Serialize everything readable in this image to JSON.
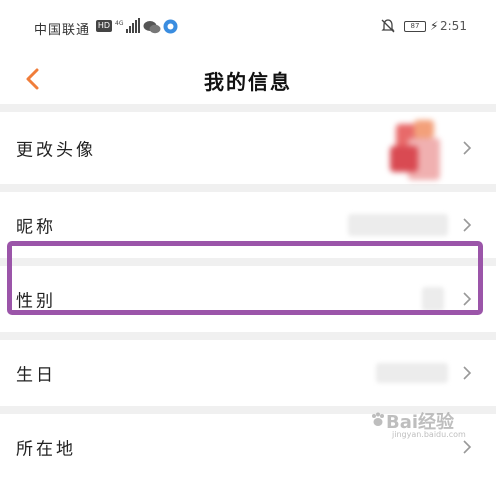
{
  "status_bar": {
    "carrier": "中国联通",
    "hd_badge": "HD",
    "battery": "87",
    "time": "2:51"
  },
  "nav": {
    "title": "我的信息"
  },
  "rows": [
    {
      "label": "更改头像"
    },
    {
      "label": "昵称"
    },
    {
      "label": "性别"
    },
    {
      "label": "生日"
    },
    {
      "label": "所在地"
    }
  ],
  "highlight_color": "#9b55a9",
  "watermark": {
    "text": "Bai经验",
    "sub": "jingyan.baidu.com"
  }
}
